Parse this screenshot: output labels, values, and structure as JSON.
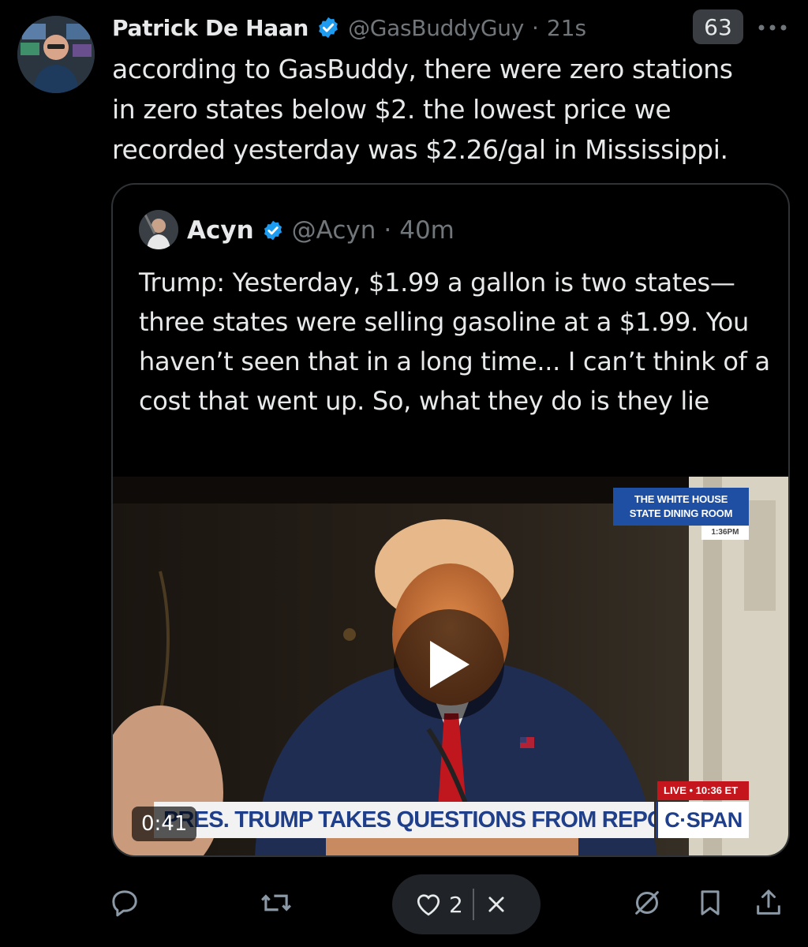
{
  "post": {
    "author_name": "Patrick De Haan",
    "handle": "@GasBuddyGuy",
    "separator": "·",
    "age": "21s",
    "view_badge": "63",
    "text": "according to GasBuddy, there were zero stations\nin zero states below $2. the lowest price we\nrecorded yesterday was $2.26/gal in Mississippi."
  },
  "quote": {
    "author_name": "Acyn",
    "handle": "@Acyn",
    "separator": "·",
    "age": "40m",
    "text": "Trump: Yesterday, $1.99 a gallon is two states— three states were selling gasoline at a $1.99. You haven’t seen that in a long time... I can’t think of a cost that went up. So, what they do is they lie",
    "video": {
      "location_line1": "THE WHITE HOUSE",
      "location_line2": "STATE DINING ROOM",
      "location_time": "1:36PM",
      "live_label": "LIVE • 10:36 ET",
      "ticker_text": "PRES. TRUMP TAKES QUESTIONS FROM REPORTERS",
      "network_logo": "C·SPAN",
      "duration": "0:41"
    }
  },
  "actions": {
    "like_count": "2"
  },
  "colors": {
    "background": "#000000",
    "text": "#e7e9ea",
    "muted": "#71767b",
    "verified": "#1d9bf0",
    "border": "#2f3336"
  },
  "icons": [
    "avatar-photo",
    "verified-badge-icon",
    "more-dots-icon",
    "reply-icon",
    "repost-icon",
    "heart-icon",
    "close-icon",
    "views-off-icon",
    "bookmark-icon",
    "share-icon",
    "play-icon"
  ]
}
